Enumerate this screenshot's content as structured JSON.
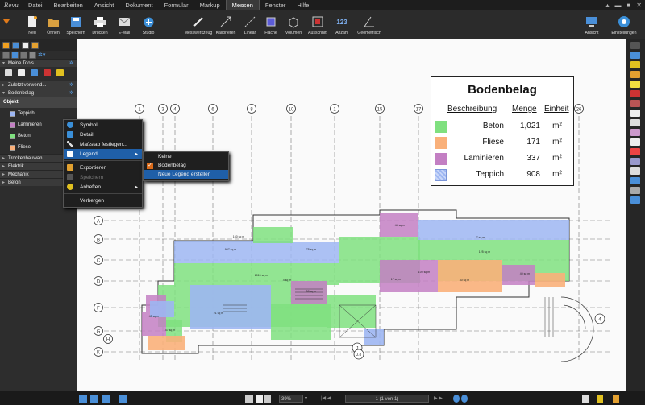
{
  "app": {
    "logo_text": "Revu"
  },
  "menu": [
    "Datei",
    "Bearbeiten",
    "Ansicht",
    "Dokument",
    "Formular",
    "Markup",
    "Messen",
    "Fenster",
    "Hilfe"
  ],
  "menu_active": "Messen",
  "toolbar": {
    "left": [
      "Neu",
      "Öffnen",
      "Speichern",
      "Drucken",
      "E-Mail",
      "Studio"
    ],
    "measure": [
      "Messwerkzeug",
      "Kalibrieren",
      "Linear",
      "Fläche",
      "Volumen",
      "Ausschnitt",
      "Anzahl",
      "Geometrisch"
    ],
    "right": [
      "Ansicht",
      "Einstellungen"
    ],
    "count_text": "123"
  },
  "tool_chest": {
    "section_my_tools": "Meine Tools",
    "recent": "Zuletzt verwend...",
    "bodenbelag": "Bodenbelag",
    "list_header": "Objekt",
    "items": [
      "Teppich",
      "Laminieren",
      "Beton",
      "Fliese"
    ],
    "sections": [
      "Trockenbauwan...",
      "Elektrik",
      "Mechanik",
      "Beton"
    ]
  },
  "context_menu": {
    "items": [
      "Symbol",
      "Detail",
      "Maßstab festlegen...",
      "Legend",
      "Exportieren",
      "Speichern",
      "Anheften",
      "Verbergen"
    ],
    "highlighted": "Legend",
    "disabled": "Speichern",
    "submenu_arrow": "▸"
  },
  "submenu": {
    "items": [
      "Keine",
      "Bodenbelag",
      "Neue Legend erstellen"
    ],
    "checked": "Bodenbelag",
    "highlighted": "Neue Legend erstellen",
    "check_glyph": "✓"
  },
  "legend": {
    "title": "Bodenbelag",
    "headers": [
      "Beschreibung",
      "Menge",
      "Einheit"
    ],
    "rows": [
      {
        "name": "Beton",
        "value": "1,021",
        "unit": "m²",
        "color": "#7fe07f",
        "pattern": "solid"
      },
      {
        "name": "Fliese",
        "value": "171",
        "unit": "m²",
        "color": "#f9b07a",
        "pattern": "solid"
      },
      {
        "name": "Laminieren",
        "value": "337",
        "unit": "m²",
        "color": "#c37fc3",
        "pattern": "solid"
      },
      {
        "name": "Teppich",
        "value": "908",
        "unit": "m²",
        "color": "#9db6f2",
        "pattern": "hatched"
      }
    ]
  },
  "drawing": {
    "col_labels": [
      "1",
      "3",
      "4",
      "6",
      "8",
      "10",
      "1",
      "15",
      "17",
      "26"
    ],
    "row_labels": [
      "A",
      "B",
      "C",
      "D",
      "F",
      "G",
      "H",
      "K"
    ],
    "area_labels": [
      "160 sq m",
      "907 sq m",
      "75 sq m",
      "100 sq m",
      "2015 sq m",
      "21 sq m",
      "50 sq m",
      "4 sq m",
      "44 sq m",
      "7 sq m",
      "125 sq m",
      "17 sq m",
      "40 sq m",
      "40 sq m",
      "45 sq m",
      "47 sq m"
    ],
    "callouts": [
      "J",
      "J.8",
      "4"
    ]
  },
  "statusbar": {
    "zoom": "39%",
    "page": "1 (1 von 1)"
  },
  "colors": {
    "beton": "#7fe07f",
    "fliese": "#f9b07a",
    "laminieren": "#c37fc3",
    "teppich": "#9db6f2",
    "accent": "#1f5fa8",
    "orange": "#d96a19"
  }
}
